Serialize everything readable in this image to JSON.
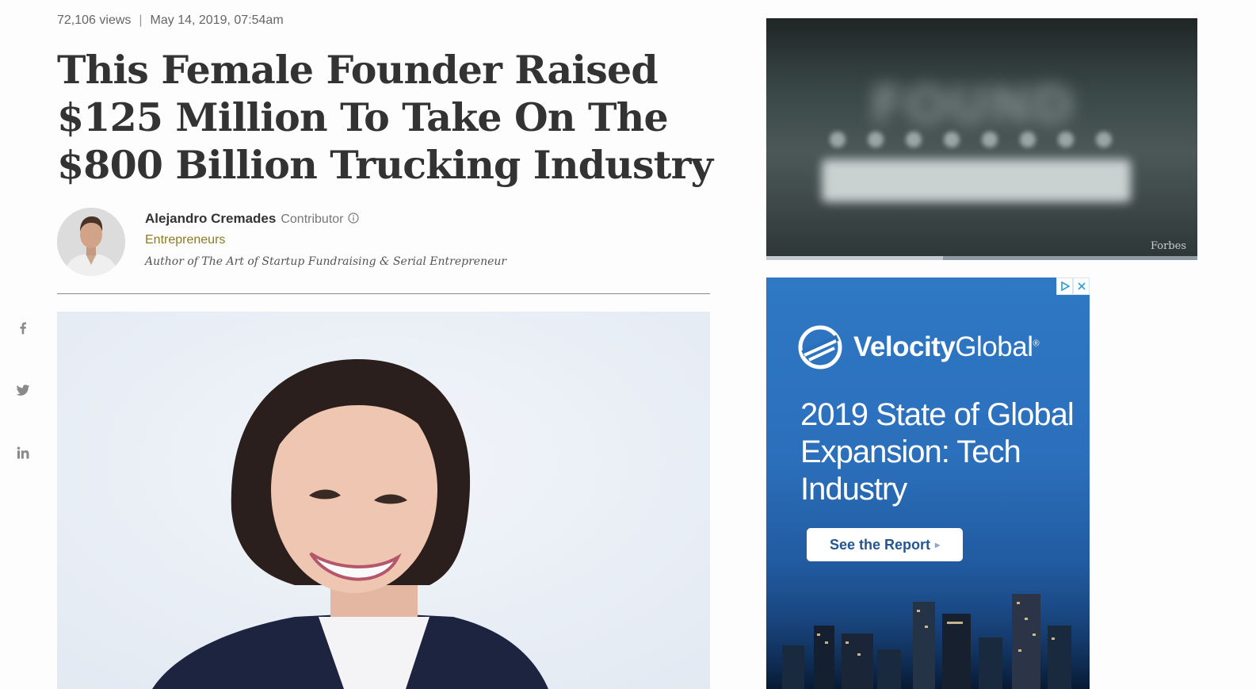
{
  "meta": {
    "views": "72,106 views",
    "separator": "|",
    "date": "May 14, 2019, 07:54am"
  },
  "headline": "This Female Founder Raised $125 Million To Take On The $800 Billion Trucking Industry",
  "author": {
    "name": "Alejandro Cremades",
    "role": "Contributor",
    "channel": "Entrepreneurs",
    "bio": "Author of The Art of Startup Fundraising & Serial Entrepreneur"
  },
  "share": {
    "icons": [
      "facebook-icon",
      "twitter-icon",
      "linkedin-icon"
    ]
  },
  "video": {
    "brand": "Forbes",
    "progress": 0.41
  },
  "ad": {
    "logo_bold": "Velocity",
    "logo_light": "Global",
    "logo_mark": "®",
    "headline": "2019 State of Global Expansion: Tech Industry",
    "cta": "See the Report",
    "cta_chevron": "▸",
    "controls": [
      "adchoices-icon",
      "close-icon"
    ]
  },
  "colors": {
    "text": "#333333",
    "muted": "#666666",
    "channel": "#8c7a21",
    "ad_blue": "#2b6fbb",
    "ad_cta_text": "#24568f"
  }
}
